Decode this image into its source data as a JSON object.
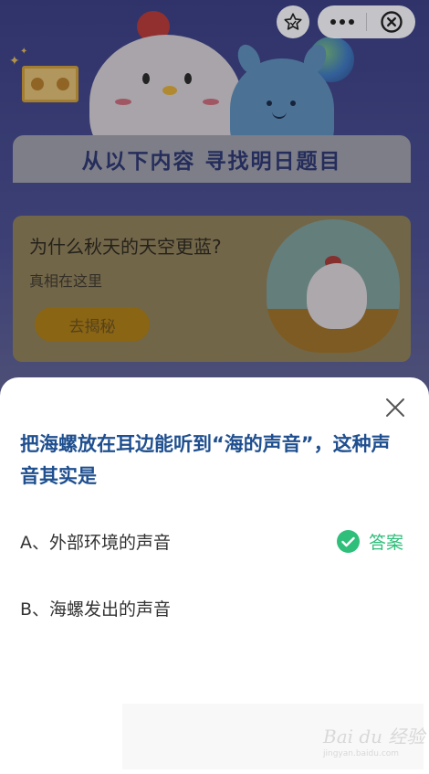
{
  "banner": {
    "text": "从以下内容 寻找明日题目"
  },
  "card": {
    "title": "为什么秋天的天空更蓝?",
    "subtitle": "真相在这里",
    "button_label": "去揭秘"
  },
  "capsule": {
    "star_icon": "star-icon",
    "more_icon": "more-dots-icon",
    "close_icon": "target-close-icon"
  },
  "quiz": {
    "question": "把海螺放在耳边能听到“海的声音”，这种声音其实是",
    "options": [
      {
        "label": "A、外部环境的声音",
        "is_answer": true
      },
      {
        "label": "B、海螺发出的声音",
        "is_answer": false
      }
    ],
    "answer_label": "答案"
  },
  "watermark": {
    "logo": "Bai du 经验",
    "url": "jingyan.baidu.com"
  },
  "colors": {
    "question_text": "#1f4f8f",
    "answer_green": "#2fbf7a",
    "sheet_bg": "#ffffff"
  }
}
